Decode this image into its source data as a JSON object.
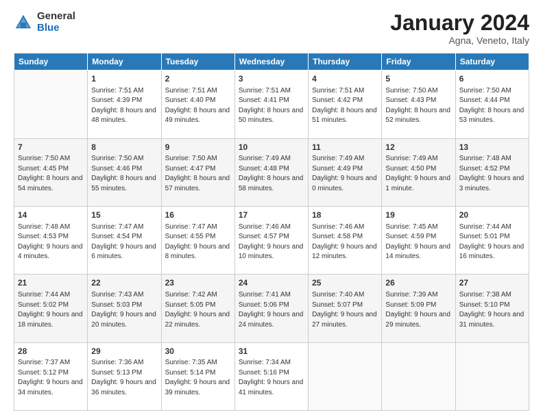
{
  "header": {
    "logo_general": "General",
    "logo_blue": "Blue",
    "month_title": "January 2024",
    "location": "Agna, Veneto, Italy"
  },
  "days_of_week": [
    "Sunday",
    "Monday",
    "Tuesday",
    "Wednesday",
    "Thursday",
    "Friday",
    "Saturday"
  ],
  "weeks": [
    [
      {
        "day": "",
        "sunrise": "",
        "sunset": "",
        "daylight": ""
      },
      {
        "day": "1",
        "sunrise": "Sunrise: 7:51 AM",
        "sunset": "Sunset: 4:39 PM",
        "daylight": "Daylight: 8 hours and 48 minutes."
      },
      {
        "day": "2",
        "sunrise": "Sunrise: 7:51 AM",
        "sunset": "Sunset: 4:40 PM",
        "daylight": "Daylight: 8 hours and 49 minutes."
      },
      {
        "day": "3",
        "sunrise": "Sunrise: 7:51 AM",
        "sunset": "Sunset: 4:41 PM",
        "daylight": "Daylight: 8 hours and 50 minutes."
      },
      {
        "day": "4",
        "sunrise": "Sunrise: 7:51 AM",
        "sunset": "Sunset: 4:42 PM",
        "daylight": "Daylight: 8 hours and 51 minutes."
      },
      {
        "day": "5",
        "sunrise": "Sunrise: 7:50 AM",
        "sunset": "Sunset: 4:43 PM",
        "daylight": "Daylight: 8 hours and 52 minutes."
      },
      {
        "day": "6",
        "sunrise": "Sunrise: 7:50 AM",
        "sunset": "Sunset: 4:44 PM",
        "daylight": "Daylight: 8 hours and 53 minutes."
      }
    ],
    [
      {
        "day": "7",
        "sunrise": "Sunrise: 7:50 AM",
        "sunset": "Sunset: 4:45 PM",
        "daylight": "Daylight: 8 hours and 54 minutes."
      },
      {
        "day": "8",
        "sunrise": "Sunrise: 7:50 AM",
        "sunset": "Sunset: 4:46 PM",
        "daylight": "Daylight: 8 hours and 55 minutes."
      },
      {
        "day": "9",
        "sunrise": "Sunrise: 7:50 AM",
        "sunset": "Sunset: 4:47 PM",
        "daylight": "Daylight: 8 hours and 57 minutes."
      },
      {
        "day": "10",
        "sunrise": "Sunrise: 7:49 AM",
        "sunset": "Sunset: 4:48 PM",
        "daylight": "Daylight: 8 hours and 58 minutes."
      },
      {
        "day": "11",
        "sunrise": "Sunrise: 7:49 AM",
        "sunset": "Sunset: 4:49 PM",
        "daylight": "Daylight: 9 hours and 0 minutes."
      },
      {
        "day": "12",
        "sunrise": "Sunrise: 7:49 AM",
        "sunset": "Sunset: 4:50 PM",
        "daylight": "Daylight: 9 hours and 1 minute."
      },
      {
        "day": "13",
        "sunrise": "Sunrise: 7:48 AM",
        "sunset": "Sunset: 4:52 PM",
        "daylight": "Daylight: 9 hours and 3 minutes."
      }
    ],
    [
      {
        "day": "14",
        "sunrise": "Sunrise: 7:48 AM",
        "sunset": "Sunset: 4:53 PM",
        "daylight": "Daylight: 9 hours and 4 minutes."
      },
      {
        "day": "15",
        "sunrise": "Sunrise: 7:47 AM",
        "sunset": "Sunset: 4:54 PM",
        "daylight": "Daylight: 9 hours and 6 minutes."
      },
      {
        "day": "16",
        "sunrise": "Sunrise: 7:47 AM",
        "sunset": "Sunset: 4:55 PM",
        "daylight": "Daylight: 9 hours and 8 minutes."
      },
      {
        "day": "17",
        "sunrise": "Sunrise: 7:46 AM",
        "sunset": "Sunset: 4:57 PM",
        "daylight": "Daylight: 9 hours and 10 minutes."
      },
      {
        "day": "18",
        "sunrise": "Sunrise: 7:46 AM",
        "sunset": "Sunset: 4:58 PM",
        "daylight": "Daylight: 9 hours and 12 minutes."
      },
      {
        "day": "19",
        "sunrise": "Sunrise: 7:45 AM",
        "sunset": "Sunset: 4:59 PM",
        "daylight": "Daylight: 9 hours and 14 minutes."
      },
      {
        "day": "20",
        "sunrise": "Sunrise: 7:44 AM",
        "sunset": "Sunset: 5:01 PM",
        "daylight": "Daylight: 9 hours and 16 minutes."
      }
    ],
    [
      {
        "day": "21",
        "sunrise": "Sunrise: 7:44 AM",
        "sunset": "Sunset: 5:02 PM",
        "daylight": "Daylight: 9 hours and 18 minutes."
      },
      {
        "day": "22",
        "sunrise": "Sunrise: 7:43 AM",
        "sunset": "Sunset: 5:03 PM",
        "daylight": "Daylight: 9 hours and 20 minutes."
      },
      {
        "day": "23",
        "sunrise": "Sunrise: 7:42 AM",
        "sunset": "Sunset: 5:05 PM",
        "daylight": "Daylight: 9 hours and 22 minutes."
      },
      {
        "day": "24",
        "sunrise": "Sunrise: 7:41 AM",
        "sunset": "Sunset: 5:06 PM",
        "daylight": "Daylight: 9 hours and 24 minutes."
      },
      {
        "day": "25",
        "sunrise": "Sunrise: 7:40 AM",
        "sunset": "Sunset: 5:07 PM",
        "daylight": "Daylight: 9 hours and 27 minutes."
      },
      {
        "day": "26",
        "sunrise": "Sunrise: 7:39 AM",
        "sunset": "Sunset: 5:09 PM",
        "daylight": "Daylight: 9 hours and 29 minutes."
      },
      {
        "day": "27",
        "sunrise": "Sunrise: 7:38 AM",
        "sunset": "Sunset: 5:10 PM",
        "daylight": "Daylight: 9 hours and 31 minutes."
      }
    ],
    [
      {
        "day": "28",
        "sunrise": "Sunrise: 7:37 AM",
        "sunset": "Sunset: 5:12 PM",
        "daylight": "Daylight: 9 hours and 34 minutes."
      },
      {
        "day": "29",
        "sunrise": "Sunrise: 7:36 AM",
        "sunset": "Sunset: 5:13 PM",
        "daylight": "Daylight: 9 hours and 36 minutes."
      },
      {
        "day": "30",
        "sunrise": "Sunrise: 7:35 AM",
        "sunset": "Sunset: 5:14 PM",
        "daylight": "Daylight: 9 hours and 39 minutes."
      },
      {
        "day": "31",
        "sunrise": "Sunrise: 7:34 AM",
        "sunset": "Sunset: 5:16 PM",
        "daylight": "Daylight: 9 hours and 41 minutes."
      },
      {
        "day": "",
        "sunrise": "",
        "sunset": "",
        "daylight": ""
      },
      {
        "day": "",
        "sunrise": "",
        "sunset": "",
        "daylight": ""
      },
      {
        "day": "",
        "sunrise": "",
        "sunset": "",
        "daylight": ""
      }
    ]
  ]
}
